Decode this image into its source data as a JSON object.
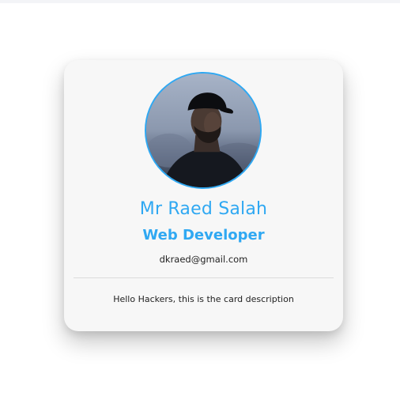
{
  "card": {
    "name": "Mr Raed Salah",
    "title": "Web Developer",
    "email": "dkraed@gmail.com",
    "description": "Hello Hackers, this is the card description"
  },
  "colors": {
    "accent": "#2fa8f2",
    "card_bg": "#f7f7f7",
    "text": "#222222",
    "divider": "#dcdcdc"
  },
  "avatar": {
    "icon": "profile-photo"
  }
}
